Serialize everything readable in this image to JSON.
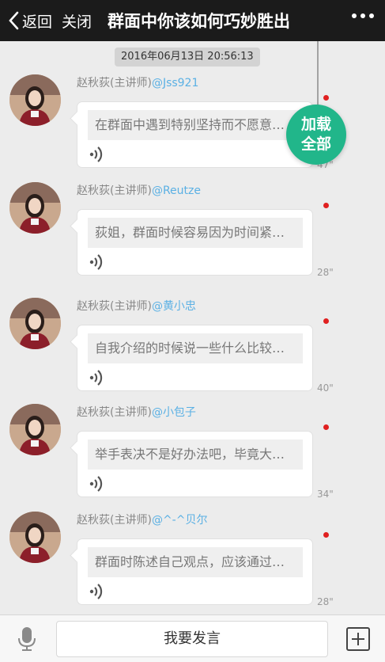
{
  "header": {
    "back_label": "返回",
    "close_label": "关闭",
    "title": "群面中你该如何巧妙胜出"
  },
  "timestamp": "2016年06月13日 20:56:13",
  "load_all": {
    "line1": "加载",
    "line2": "全部"
  },
  "messages": [
    {
      "sender": "赵秋荻(主讲师)",
      "mention": "@Jss921",
      "preview": "在群面中遇到特别坚持而不愿意妥协的人该怎么办",
      "duration": "47\""
    },
    {
      "sender": "赵秋荻(主讲师)",
      "mention": "@Reutze",
      "preview": "荻姐，群面时候容易因为时间紧张而慌乱怎么办",
      "duration": "28\""
    },
    {
      "sender": "赵秋荻(主讲师)",
      "mention": "@黄小忠",
      "preview": "自我介绍的时候说一些什么比较好呢",
      "duration": "40\""
    },
    {
      "sender": "赵秋荻(主讲师)",
      "mention": "@小包子",
      "preview": "举手表决不是好办法吧，毕竟大家意见不同",
      "duration": "34\""
    },
    {
      "sender": "赵秋荻(主讲师)",
      "mention": "@^-^贝尔",
      "preview": "群面时陈述自己观点，应该通过什么方式",
      "duration": "28\""
    }
  ],
  "footer": {
    "speak_label": "我要发言"
  },
  "colors": {
    "header_bg": "#1b1b1b",
    "accent": "#21b68a",
    "mention": "#5ab0e4",
    "unread": "#e02020"
  },
  "icons": [
    "back-chevron-icon",
    "more-dots-icon",
    "voice-wave-icon",
    "microphone-icon",
    "plus-icon"
  ]
}
